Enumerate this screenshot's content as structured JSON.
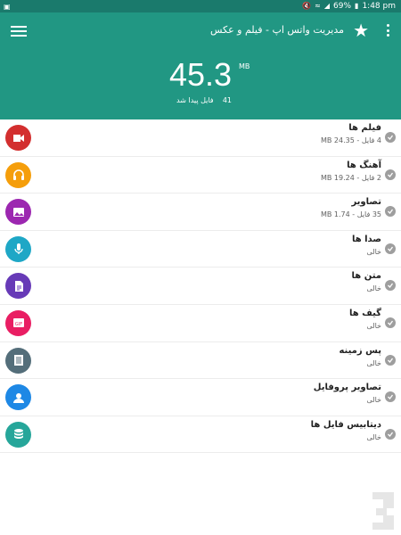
{
  "status_bar": {
    "battery": "69%",
    "time": "1:48 pm",
    "icons": [
      "gallery-icon",
      "mute-icon",
      "wifi-icon",
      "signal-icon",
      "battery-icon"
    ]
  },
  "app_bar": {
    "title": "مدیریت واتس اپ - فیلم و عکس",
    "icons": [
      "menu-icon",
      "star-icon",
      "more-vert-icon"
    ]
  },
  "summary": {
    "total_size": "45.3",
    "unit": "MB",
    "files_count": "41",
    "files_label": "فایل پیدا شد"
  },
  "colors": {
    "primary": "#219783",
    "status_bar": "#1a7a6c"
  },
  "items": [
    {
      "title": "فیلم ها",
      "count": "4",
      "count_label": "فایل",
      "size": "MB 24.35",
      "empty": "",
      "icon": "video-camera-icon",
      "color": "#d32f2f"
    },
    {
      "title": "آهنگ ها",
      "count": "2",
      "count_label": "فایل",
      "size": "MB 19.24",
      "empty": "",
      "icon": "headphones-icon",
      "color": "#f59e0b"
    },
    {
      "title": "تصاویر",
      "count": "35",
      "count_label": "فایل",
      "size": "MB 1.74",
      "empty": "",
      "icon": "image-icon",
      "color": "#9c27b0"
    },
    {
      "title": "صدا ها",
      "count": "",
      "count_label": "",
      "size": "",
      "empty": "خالی",
      "icon": "microphone-icon",
      "color": "#1ea7c6"
    },
    {
      "title": "متن ها",
      "count": "",
      "count_label": "",
      "size": "",
      "empty": "خالی",
      "icon": "document-icon",
      "color": "#673ab7"
    },
    {
      "title": "گیف ها",
      "count": "",
      "count_label": "",
      "size": "",
      "empty": "خالی",
      "icon": "gif-icon",
      "color": "#e91e63"
    },
    {
      "title": "پس زمینه",
      "count": "",
      "count_label": "",
      "size": "",
      "empty": "خالی",
      "icon": "wallpaper-icon",
      "color": "#546e7a"
    },
    {
      "title": "تصاویر پروفایل",
      "count": "",
      "count_label": "",
      "size": "",
      "empty": "خالی",
      "icon": "profile-icon",
      "color": "#1e88e5"
    },
    {
      "title": "دیتابیس فایل ها",
      "count": "",
      "count_label": "",
      "size": "",
      "empty": "خالی",
      "icon": "database-icon",
      "color": "#26a69a"
    }
  ]
}
